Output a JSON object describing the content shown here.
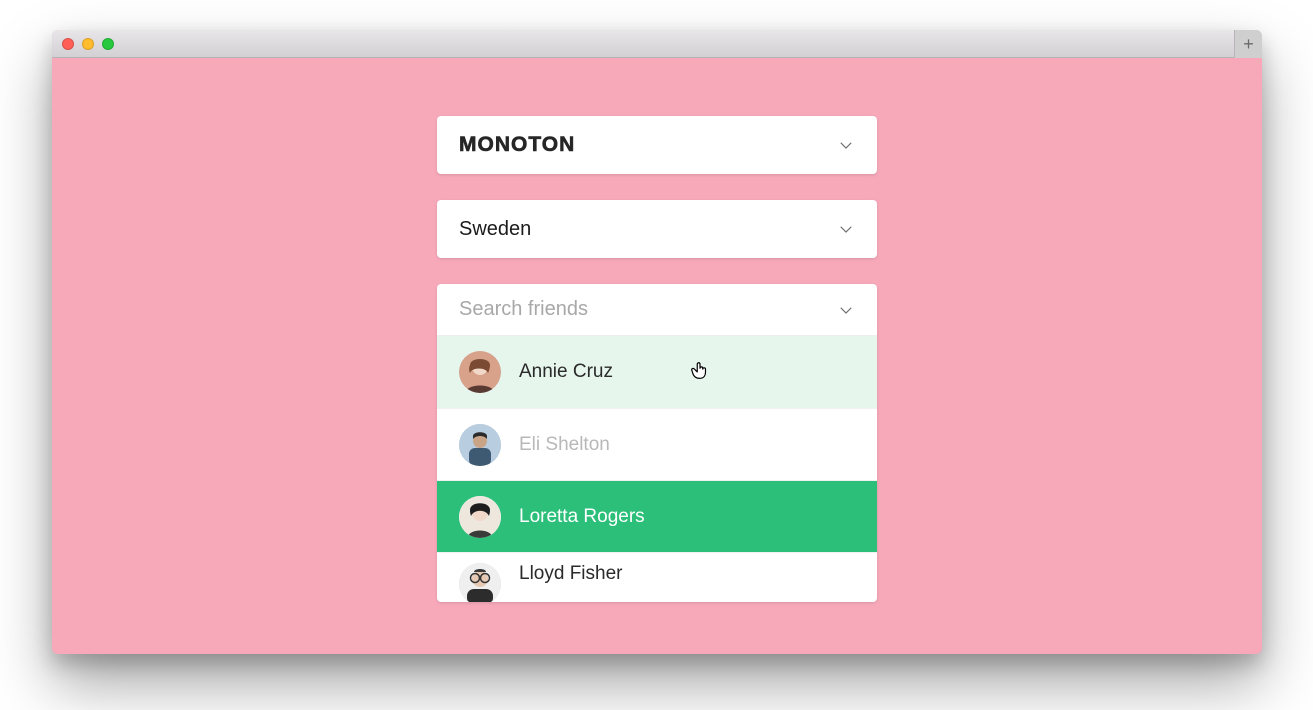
{
  "window": {
    "plus_label": "+"
  },
  "selects": {
    "font": {
      "value": "Monoton"
    },
    "country": {
      "value": "Sweden"
    }
  },
  "friends_dropdown": {
    "placeholder": "Search friends",
    "options": [
      {
        "name": "Annie Cruz",
        "state": "hover",
        "avatar_bg": "#c99078"
      },
      {
        "name": "Eli Shelton",
        "state": "disabled",
        "avatar_bg": "#7fa7c9"
      },
      {
        "name": "Loretta Rogers",
        "state": "selected",
        "avatar_bg": "#d8d0c6"
      },
      {
        "name": "Lloyd Fisher",
        "state": "default",
        "avatar_bg": "#e2e2e2"
      }
    ]
  },
  "colors": {
    "page_bg": "#f7a9ba",
    "accent": "#2bbf7a",
    "hover_bg": "#e6f6ed"
  }
}
